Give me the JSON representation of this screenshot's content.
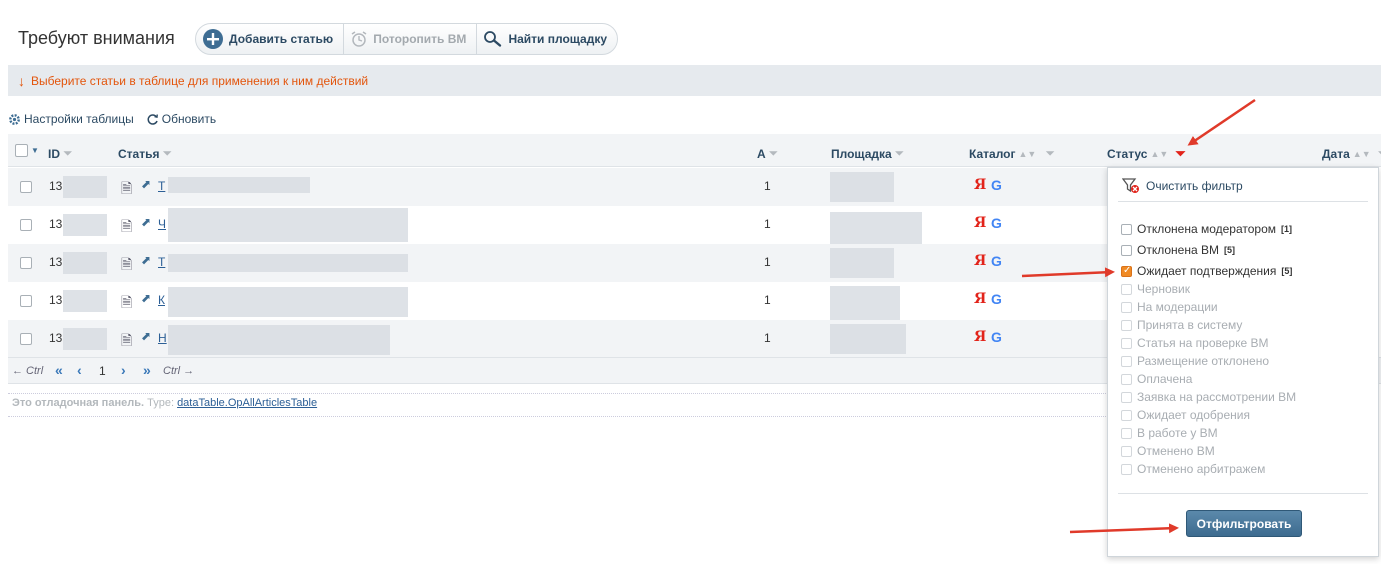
{
  "page": {
    "title": "Требуют внимания"
  },
  "toolbar": {
    "add_article": "Добавить статью",
    "hurry_vm": "Поторопить ВМ",
    "find_site": "Найти площадку"
  },
  "alert": {
    "arrow": "↓",
    "text": "Выберите статьи в таблице для применения к ним действий"
  },
  "links": {
    "table_settings": "Настройки таблицы",
    "refresh": "Обновить"
  },
  "table": {
    "columns": {
      "id": "ID",
      "article": "Статья",
      "a": "A",
      "site": "Площадка",
      "catalog": "Каталог",
      "status": "Статус",
      "date": "Дата"
    },
    "rows": [
      {
        "id": "13",
        "title": "Т",
        "a": "1"
      },
      {
        "id": "13",
        "title": "Ч",
        "a": "1"
      },
      {
        "id": "13",
        "title": "Т",
        "a": "1"
      },
      {
        "id": "13",
        "title": "К",
        "a": "1"
      },
      {
        "id": "13",
        "title": "Н",
        "a": "1"
      }
    ],
    "catalog_icons": {
      "yandex": "Я",
      "google": "G"
    }
  },
  "pager": {
    "prev_ctrl": "← Ctrl",
    "first": "«",
    "prev": "‹",
    "page": "1",
    "next": "›",
    "last": "»",
    "next_ctrl": "Ctrl →"
  },
  "debug": {
    "label": "Это отладочная панель.",
    "type_label": "Type:",
    "type_value": "dataTable.OpAllArticlesTable"
  },
  "filter": {
    "clear": "Очистить фильтр",
    "options": [
      {
        "label": "Отклонена модератором",
        "count": "[1]",
        "enabled": true,
        "checked": false
      },
      {
        "label": "Отклонена ВМ",
        "count": "[5]",
        "enabled": true,
        "checked": false
      },
      {
        "label": "Ожидает подтверждения",
        "count": "[5]",
        "enabled": true,
        "checked": true
      },
      {
        "label": "Черновик",
        "count": "",
        "enabled": false,
        "checked": false
      },
      {
        "label": "На модерации",
        "count": "",
        "enabled": false,
        "checked": false
      },
      {
        "label": "Принята в систему",
        "count": "",
        "enabled": false,
        "checked": false
      },
      {
        "label": "Статья на проверке ВМ",
        "count": "",
        "enabled": false,
        "checked": false
      },
      {
        "label": "Размещение отклонено",
        "count": "",
        "enabled": false,
        "checked": false
      },
      {
        "label": "Оплачена",
        "count": "",
        "enabled": false,
        "checked": false
      },
      {
        "label": "Заявка на рассмотрении ВМ",
        "count": "",
        "enabled": false,
        "checked": false
      },
      {
        "label": "Ожидает одобрения",
        "count": "",
        "enabled": false,
        "checked": false
      },
      {
        "label": "В работе у ВМ",
        "count": "",
        "enabled": false,
        "checked": false
      },
      {
        "label": "Отменено ВМ",
        "count": "",
        "enabled": false,
        "checked": false
      },
      {
        "label": "Отменено арбитражем",
        "count": "",
        "enabled": false,
        "checked": false
      }
    ],
    "apply": "Отфильтровать"
  },
  "colors": {
    "accent": "#2c4a63",
    "alert_text": "#e3550c",
    "arrow_red": "#e03a2a",
    "checked_orange": "#f08a24"
  }
}
